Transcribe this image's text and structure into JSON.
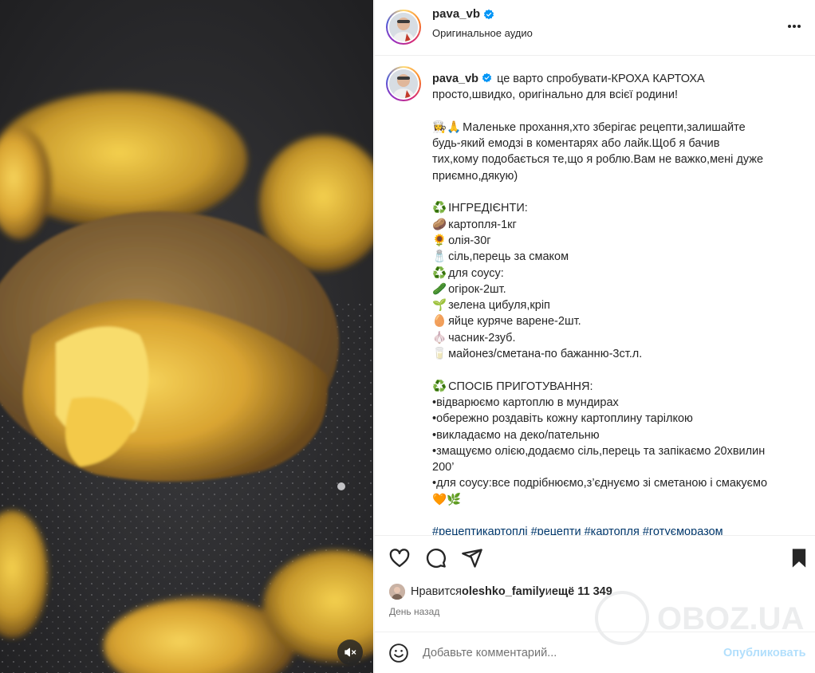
{
  "post": {
    "username": "pava_vb",
    "audio": "Оригинальное аудио",
    "more_icon": "more-horizontal-icon"
  },
  "caption": {
    "username": "pava_vb",
    "lines": [
      {
        "text": " це варто спробувати-КРОХА КАРТОХА",
        "first": true
      },
      {
        "text": "просто,швидко, оригінально для всієї родини!"
      },
      {
        "gap": true
      },
      {
        "emoji": "👩‍🍳🙏",
        "text": "Маленьке прохання,хто зберігає рецепти,залишайте"
      },
      {
        "text": "будь-який емодзі в коментарях або лайк.Щоб я бачив"
      },
      {
        "text": "тих,кому подобається те,що я роблю.Вам не важко,мені дуже"
      },
      {
        "text": "приємно,дякую)"
      },
      {
        "gap": true
      },
      {
        "emoji": "♻️",
        "text": "ІНГРЕДІЄНТИ:"
      },
      {
        "emoji": "🥔",
        "text": "картопля-1кг"
      },
      {
        "emoji": "🌻",
        "text": "олія-30г"
      },
      {
        "emoji": "🧂",
        "text": "сіль,перець за смаком"
      },
      {
        "emoji": "♻️",
        "text": "для соусу:"
      },
      {
        "emoji": "🥒",
        "text": "огірок-2шт."
      },
      {
        "emoji": "🌱",
        "text": "зелена цибуля,кріп"
      },
      {
        "emoji": "🥚",
        "text": "яйце куряче варене-2шт."
      },
      {
        "emoji": "🧄",
        "text": "часник-2зуб."
      },
      {
        "emoji": "🥛",
        "text": "майонез/сметана-по бажанню-3ст.л."
      },
      {
        "gap": true
      },
      {
        "emoji": "♻️",
        "text": "СПОСІБ ПРИГОТУВАННЯ:"
      },
      {
        "text": "•відварюємо картоплю в мундирах"
      },
      {
        "text": "•обережно роздавіть кожну картоплину тарілкою"
      },
      {
        "text": "•викладаємо на деко/пательню"
      },
      {
        "text": "•змащуємо олією,додаємо сіль,перець та запікаємо 20хвилин"
      },
      {
        "text": "200’"
      },
      {
        "text": "•для соусу:все подрібнюємо,з’єднуємо зі сметаною і смакуємо"
      },
      {
        "emoji": "🧡🌿",
        "text": ""
      },
      {
        "gap": true
      },
      {
        "text": "#рецептикартоплі #рецепти #картопля #готуєморазом",
        "hashtags": true
      }
    ]
  },
  "actions": {
    "like_icon": "heart-icon",
    "comment_icon": "comment-icon",
    "share_icon": "share-icon",
    "save_icon": "bookmark-icon"
  },
  "likes": {
    "prefix": "Нравится ",
    "user": "oleshko_family",
    "middle": " и ",
    "count": "ещё 11 349"
  },
  "time": "День назад",
  "comment": {
    "placeholder": "Добавьте комментарий...",
    "post_label": "Опубликовать"
  },
  "watermark": "OBOZ.UA",
  "colors": {
    "accent": "#0095f6",
    "post_disabled": "#b2dffc",
    "hashtag": "#00376b",
    "secondary": "#737373"
  }
}
